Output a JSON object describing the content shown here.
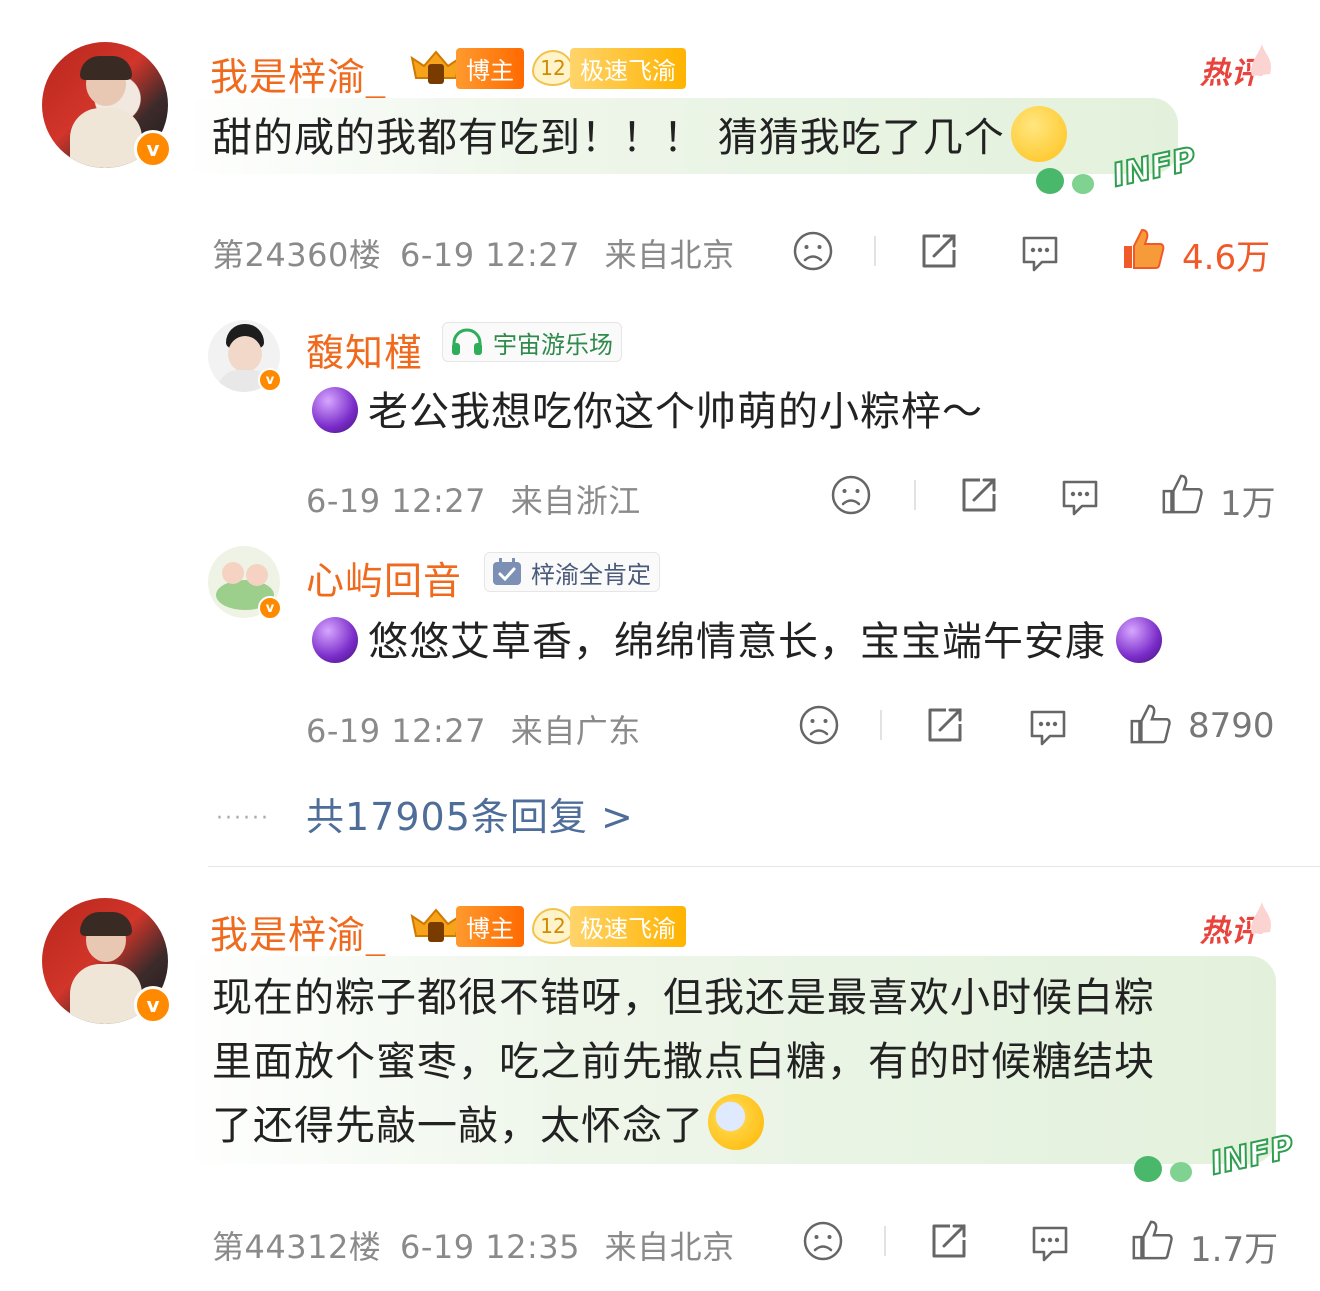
{
  "comments": [
    {
      "author": "我是梓渝_",
      "badge_blogger": "博主",
      "badge_level": "12",
      "badge_fan": "极速飞渝",
      "hot_label": "热评",
      "text": "甜的咸的我都有吃到！！！ 猜猜我吃了几个",
      "floor": "第24360楼",
      "time": "6-19 12:27",
      "location": "来自北京",
      "likes": "4.6万",
      "liked": true,
      "personality_tag": "INFP",
      "replies": [
        {
          "author": "馥知槿",
          "tag": "宇宙游乐场",
          "text": "老公我想吃你这个帅萌的小粽梓～",
          "time": "6-19 12:27",
          "location": "来自浙江",
          "likes": "1万"
        },
        {
          "author": "心屿回音",
          "tag": "梓渝全肯定",
          "text": "悠悠艾草香，绵绵情意长，宝宝端午安康",
          "time": "6-19 12:27",
          "location": "来自广东",
          "likes": "8790"
        }
      ],
      "reply_count_label": "共17905条回复 >"
    },
    {
      "author": "我是梓渝_",
      "badge_blogger": "博主",
      "badge_level": "12",
      "badge_fan": "极速飞渝",
      "hot_label": "热评",
      "text_lines": [
        "现在的粽子都很不错呀，但我还是最喜欢小时候白粽",
        "里面放个蜜枣，吃之前先撒点白糖，有的时候糖结块",
        "了还得先敲一敲，太怀念了"
      ],
      "floor": "第44312楼",
      "time": "6-19 12:35",
      "location": "来自北京",
      "likes": "1.7万",
      "liked": false,
      "personality_tag": "INFP"
    }
  ],
  "colors": {
    "name": "#f06a1e",
    "meta": "#8a8a8a",
    "link": "#4f6d99",
    "hot": "#e8433c",
    "liked": "#f05a28"
  },
  "icons": [
    "dislike-icon",
    "share-icon",
    "comment-icon",
    "like-icon",
    "headphones-icon",
    "calendar-check-icon",
    "crystal-ball-emoji",
    "thinking-emoji",
    "crying-laugh-emoji",
    "verified-badge-icon"
  ]
}
